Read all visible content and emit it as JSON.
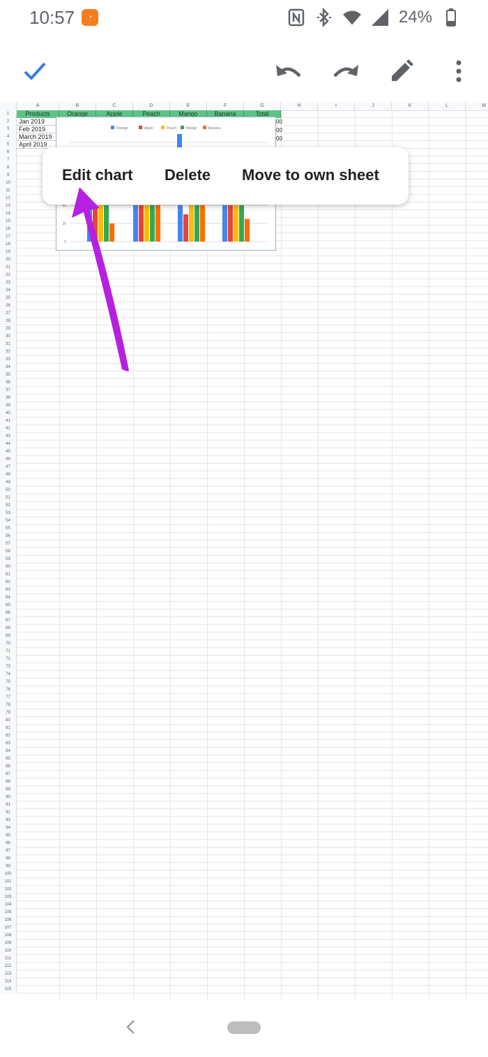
{
  "status_bar": {
    "time": "10:57",
    "battery": "24%",
    "icons": [
      "app-badge-icon",
      "nfc-icon",
      "bluetooth-icon",
      "wifi-icon",
      "signal-icon",
      "battery-icon"
    ],
    "badge_color": "#f57c1f"
  },
  "toolbar": {
    "accent": "#3b78e7",
    "icons": [
      "check-icon",
      "undo-icon",
      "redo-icon",
      "pencil-icon",
      "more-vert-icon"
    ]
  },
  "sheet": {
    "columns": [
      "A",
      "B",
      "C",
      "D",
      "E",
      "F",
      "G",
      "H",
      "I",
      "J",
      "K",
      "L",
      "M"
    ],
    "row_count": 115,
    "header_row": [
      "Products",
      "Orange",
      "Apple",
      "Peach",
      "Mango",
      "Banana",
      "Total"
    ],
    "data_rows": [
      "Jan 2019",
      "Feb 2019",
      "March 2019",
      "April 2019"
    ],
    "total_fragments": [
      "00",
      "00",
      "00"
    ],
    "header_color": "#5dc486"
  },
  "chart": {
    "legend": [
      "Orange",
      "Apple",
      "Peach",
      "Mango",
      "Banana"
    ],
    "colors": [
      "#4285f4",
      "#ea4335",
      "#fbbc04",
      "#34a853",
      "#ff6d01"
    ],
    "y_ticks": [
      "0",
      "20",
      "40"
    ]
  },
  "chart_data": {
    "type": "bar",
    "categories": [
      "Jan 2019",
      "Feb 2019",
      "March 2019",
      "April 2019"
    ],
    "series": [
      {
        "name": "Orange",
        "values": [
          40,
          40,
          40,
          40
        ]
      },
      {
        "name": "Apple",
        "values": [
          40,
          40,
          30,
          40
        ]
      },
      {
        "name": "Peach",
        "values": [
          40,
          40,
          40,
          40
        ]
      },
      {
        "name": "Mango",
        "values": [
          40,
          40,
          40,
          40
        ]
      },
      {
        "name": "Banana",
        "values": [
          20,
          40,
          40,
          25
        ]
      }
    ],
    "ylim": [
      0,
      40
    ]
  },
  "context_menu": {
    "edit_label": "Edit chart",
    "delete_label": "Delete",
    "move_label": "Move to own sheet"
  },
  "annotation": {
    "arrow_color": "#b620e0"
  },
  "nav_bar": {
    "icons": [
      "back-icon",
      "home-pill"
    ]
  }
}
